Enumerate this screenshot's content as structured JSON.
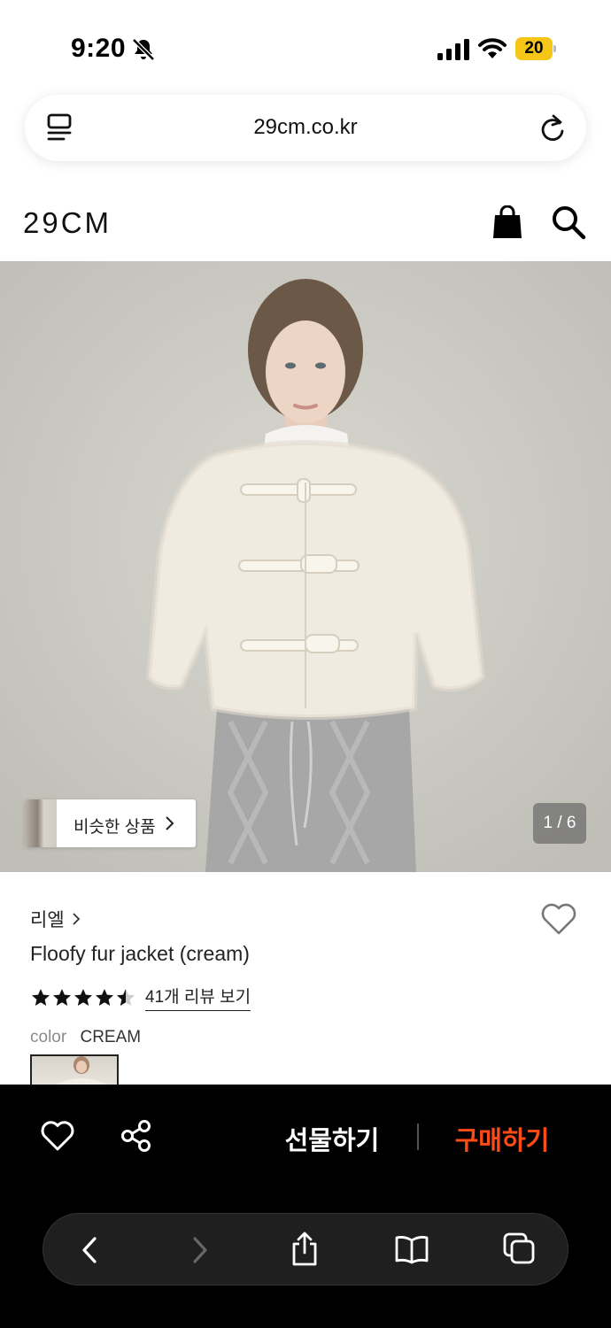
{
  "status_bar": {
    "time": "9:20",
    "battery_level": "20",
    "battery_color": "#f5c518"
  },
  "browser": {
    "url": "29cm.co.kr",
    "icons": {
      "tabs": "tabs-list-icon",
      "reload": "reload-icon"
    }
  },
  "header": {
    "logo": "29CM",
    "icons": {
      "bag": "shopping-bag-icon",
      "search": "search-icon"
    }
  },
  "gallery": {
    "similar_label": "비슷한 상품",
    "page_indicator": "1 / 6",
    "current_page": 1,
    "total_pages": 6
  },
  "product": {
    "brand": "리엘",
    "title": "Floofy fur jacket (cream)",
    "rating_stars": 4.5,
    "review_link": "41개 리뷰 보기",
    "color_label": "color",
    "color_value": "CREAM"
  },
  "action_bar": {
    "gift_label": "선물하기",
    "buy_label": "구매하기",
    "buy_color": "#ff4b16"
  },
  "safari_toolbar": {
    "icons": [
      "back-icon",
      "forward-icon",
      "share-icon",
      "bookmarks-icon",
      "tabs-icon"
    ]
  }
}
